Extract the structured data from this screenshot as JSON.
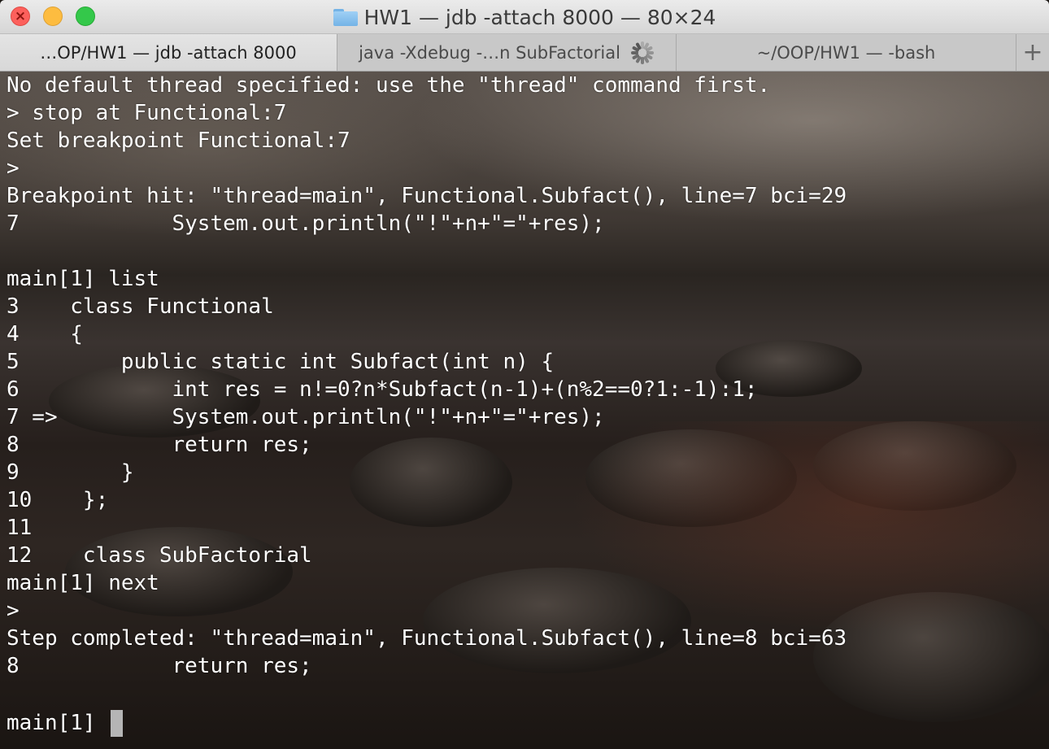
{
  "window": {
    "title": "HW1 — jdb -attach 8000 — 80×24",
    "folder_icon": "folder-icon"
  },
  "tabs": [
    {
      "label": "…OP/HW1 — jdb -attach 8000",
      "active": true
    },
    {
      "label": "java -Xdebug -…n SubFactorial",
      "active": false,
      "busy": true
    },
    {
      "label": "~/OOP/HW1 — -bash",
      "active": false
    }
  ],
  "new_tab_label": "+",
  "terminal": {
    "lines": [
      "No default thread specified: use the \"thread\" command first.",
      "> stop at Functional:7",
      "Set breakpoint Functional:7",
      ">",
      "Breakpoint hit: \"thread=main\", Functional.Subfact(), line=7 bci=29",
      "7            System.out.println(\"!\"+n+\"=\"+res);",
      "",
      "main[1] list",
      "3    class Functional",
      "4    {",
      "5        public static int Subfact(int n) {",
      "6            int res = n!=0?n*Subfact(n-1)+(n%2==0?1:-1):1;",
      "7 =>         System.out.println(\"!\"+n+\"=\"+res);",
      "8            return res;",
      "9        }",
      "10    };",
      "11",
      "12    class SubFactorial",
      "main[1] next",
      ">",
      "Step completed: \"thread=main\", Functional.Subfact(), line=8 bci=63",
      "8            return res;",
      ""
    ],
    "prompt": "main[1]"
  },
  "colors": {
    "text": "#ffffff",
    "cursor": "#b5b5b5",
    "close": "#fc605c",
    "minimize": "#fdbc40",
    "zoom": "#34c84a"
  }
}
